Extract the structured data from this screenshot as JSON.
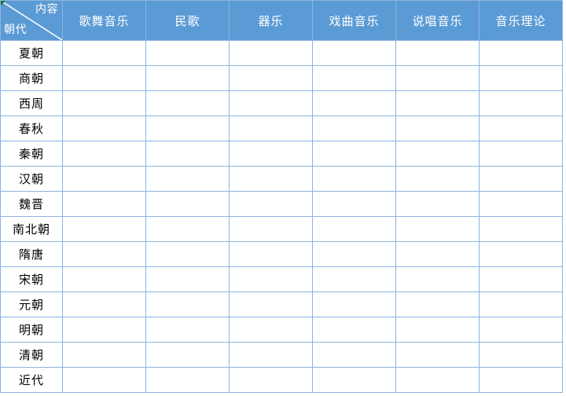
{
  "table": {
    "corner": {
      "top_label": "内容",
      "bottom_label": "朝代",
      "diagonal": true,
      "marker_color": "#1d6b38"
    },
    "column_headers": [
      "歌舞音乐",
      "民歌",
      "器乐",
      "戏曲音乐",
      "说唱音乐",
      "音乐理论"
    ],
    "row_headers": [
      "夏朝",
      "商朝",
      "西周",
      "春秋",
      "秦朝",
      "汉朝",
      "魏晋",
      "南北朝",
      "隋唐",
      "宋朝",
      "元朝",
      "明朝",
      "清朝",
      "近代"
    ],
    "cells": [
      [
        "",
        "",
        "",
        "",
        "",
        ""
      ],
      [
        "",
        "",
        "",
        "",
        "",
        ""
      ],
      [
        "",
        "",
        "",
        "",
        "",
        ""
      ],
      [
        "",
        "",
        "",
        "",
        "",
        ""
      ],
      [
        "",
        "",
        "",
        "",
        "",
        ""
      ],
      [
        "",
        "",
        "",
        "",
        "",
        ""
      ],
      [
        "",
        "",
        "",
        "",
        "",
        ""
      ],
      [
        "",
        "",
        "",
        "",
        "",
        ""
      ],
      [
        "",
        "",
        "",
        "",
        "",
        ""
      ],
      [
        "",
        "",
        "",
        "",
        "",
        ""
      ],
      [
        "",
        "",
        "",
        "",
        "",
        ""
      ],
      [
        "",
        "",
        "",
        "",
        "",
        ""
      ],
      [
        "",
        "",
        "",
        "",
        "",
        ""
      ],
      [
        "",
        "",
        "",
        "",
        "",
        ""
      ]
    ],
    "colors": {
      "header_fill": "#5b9bd5",
      "header_text": "#ffffff",
      "border": "#8eb4de",
      "body_fill": "#ffffff",
      "body_text": "#000000"
    }
  }
}
